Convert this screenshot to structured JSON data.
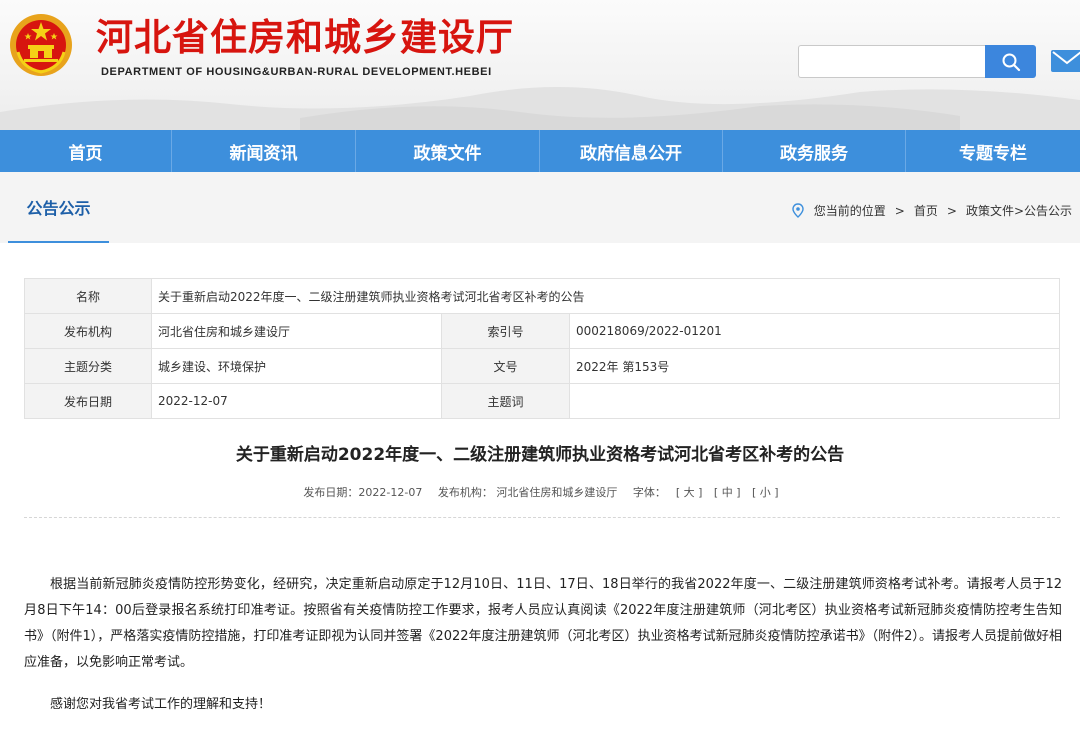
{
  "header": {
    "title": "河北省住房和城乡建设厅",
    "subtitle": "DEPARTMENT OF HOUSING&URBAN-RURAL DEVELOPMENT.HEBEI",
    "search": {
      "placeholder": "",
      "value": ""
    },
    "icons": [
      "national-emblem-icon",
      "search-icon",
      "mail-icon"
    ]
  },
  "nav": {
    "items": [
      "首页",
      "新闻资讯",
      "政策文件",
      "政府信息公开",
      "政务服务",
      "专题专栏"
    ]
  },
  "position_bar": {
    "section_title": "公告公示",
    "location_label": "您当前的位置",
    "crumbs": [
      "首页",
      "政策文件>公告公示"
    ]
  },
  "info_table": {
    "name_label": "名称",
    "name_value": "关于重新启动2022年度一、二级注册建筑师执业资格考试河北省考区补考的公告",
    "rows": [
      {
        "k1": "发布机构",
        "v1": "河北省住房和城乡建设厅",
        "k2": "索引号",
        "v2": "000218069/2022-01201"
      },
      {
        "k1": "主题分类",
        "v1": "城乡建设、环境保护",
        "k2": "文号",
        "v2": "2022年 第153号"
      },
      {
        "k1": "发布日期",
        "v1": "2022-12-07",
        "k2": "主题词",
        "v2": ""
      }
    ]
  },
  "article": {
    "title": "关于重新启动2022年度一、二级注册建筑师执业资格考试河北省考区补考的公告",
    "meta": {
      "date": "发布日期：2022-12-07",
      "org": "发布机构：  河北省住房和城乡建设厅",
      "font_label": "字体：",
      "font_sizes": [
        "[ 大 ]",
        "[ 中 ]",
        "[ 小 ]"
      ]
    },
    "paragraphs": [
      "根据当前新冠肺炎疫情防控形势变化，经研究，决定重新启动原定于12月10日、11日、17日、18日举行的我省2022年度一、二级注册建筑师资格考试补考。请报考人员于12月8日下午14：00后登录报名系统打印准考证。按照省有关疫情防控工作要求，报考人员应认真阅读《2022年度注册建筑师（河北考区）执业资格考试新冠肺炎疫情防控考生告知书》（附件1），严格落实疫情防控措施，打印准考证即视为认同并签署《2022年度注册建筑师（河北考区）执业资格考试新冠肺炎疫情防控承诺书》（附件2）。请报考人员提前做好相应准备，以免影响正常考试。",
      "感谢您对我省考试工作的理解和支持！"
    ]
  },
  "colors": {
    "brand_red": "#d7150f",
    "nav_blue": "#3d8fdc",
    "title_blue": "#1d5fa8"
  }
}
